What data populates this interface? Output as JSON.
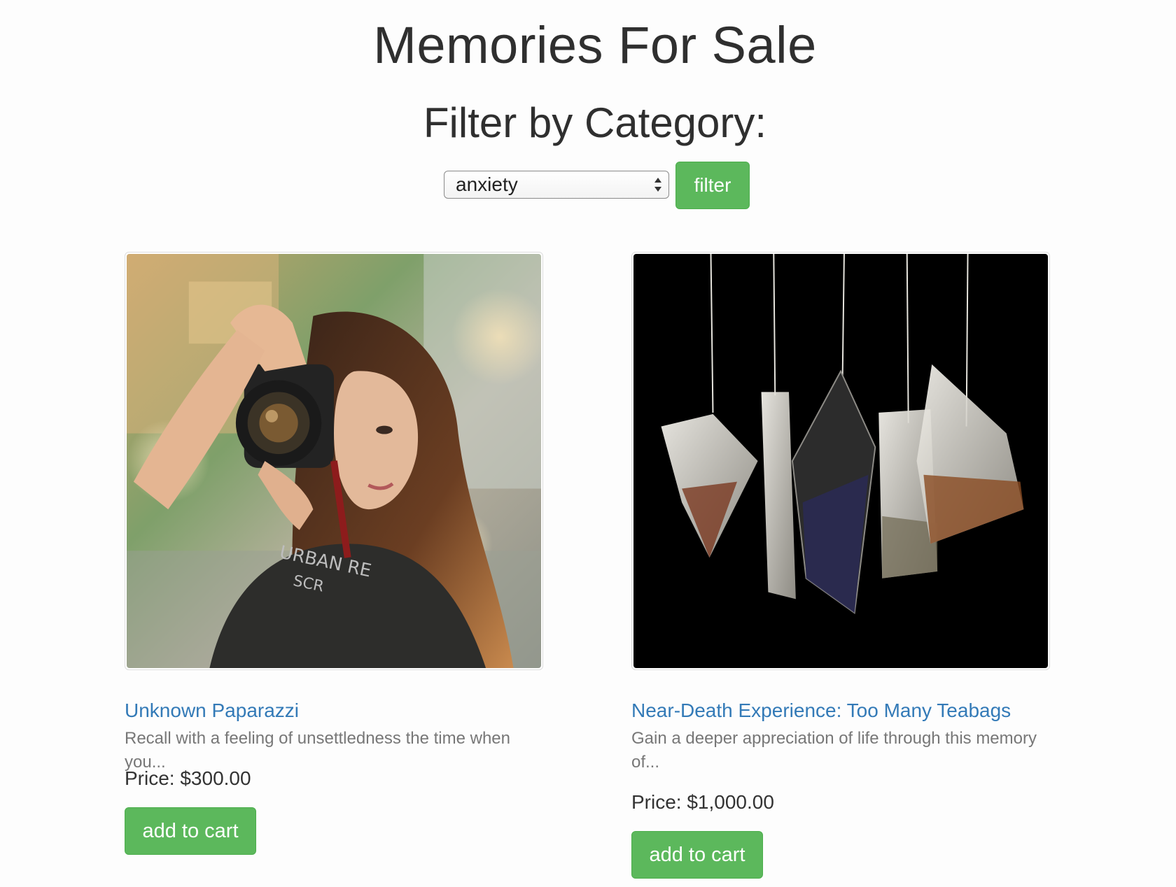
{
  "header": {
    "title": "Memories For Sale",
    "filter_heading": "Filter by Category:"
  },
  "filter": {
    "selected_category": "anxiety",
    "button_label": "filter",
    "accent_color": "#5cb85c"
  },
  "products": [
    {
      "title": "Unknown Paparazzi",
      "description": "Recall with a feeling of unsettledness the time when you...",
      "price": "Price: $300.00",
      "button_label": "add to cart",
      "image": "woman-with-camera-photo"
    },
    {
      "title": "Near-Death Experience: Too Many Teabags",
      "description": "Gain a deeper appreciation of life through this memory of...",
      "price": "Price: $1,000.00",
      "button_label": "add to cart",
      "image": "hanging-teabags-photo"
    }
  ],
  "colors": {
    "link": "#337ab7",
    "button": "#5cb85c",
    "muted_text": "#777777"
  }
}
